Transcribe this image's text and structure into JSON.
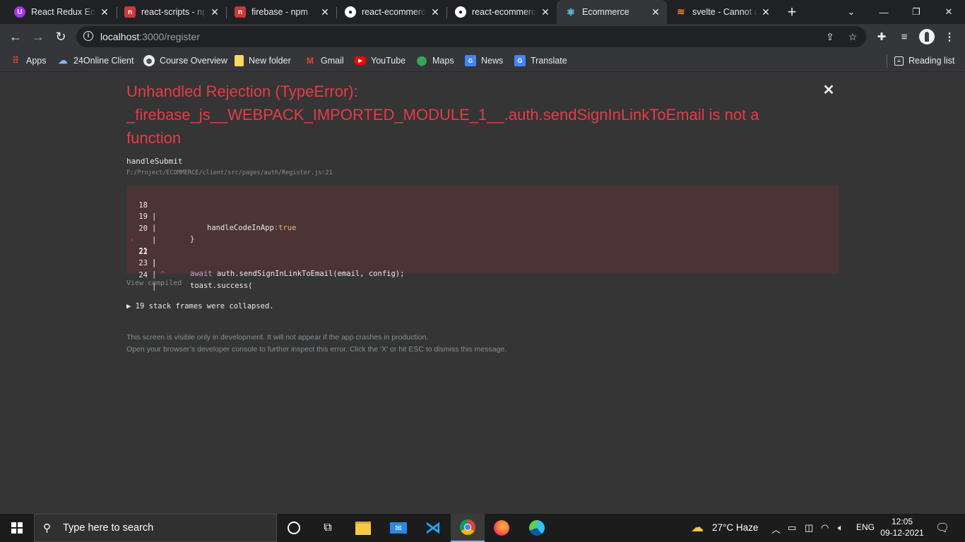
{
  "tabs": [
    {
      "title": "React Redux Ecom",
      "icon": "udemy-icon",
      "color": "#a435f0"
    },
    {
      "title": "react-scripts - np",
      "icon": "npm-icon",
      "color": "#cb3837"
    },
    {
      "title": "firebase - npm",
      "icon": "npm-icon",
      "color": "#cb3837"
    },
    {
      "title": "react-ecommerce",
      "icon": "github-icon",
      "color": "#ffffff"
    },
    {
      "title": "react-ecommerce",
      "icon": "github-icon",
      "color": "#ffffff"
    },
    {
      "title": "Ecommerce",
      "icon": "react-icon",
      "color": "#61dafb"
    },
    {
      "title": "svelte - Cannot a",
      "icon": "stackoverflow-icon",
      "color": "#f48024"
    }
  ],
  "address": {
    "host": "localhost",
    "path": ":3000/register"
  },
  "bookmarks": [
    {
      "label": "Apps",
      "icon": "apps-grid-icon",
      "color": "#ea4335"
    },
    {
      "label": "24Online Client",
      "icon": "cloud-icon",
      "color": "#8ab4f8"
    },
    {
      "label": "Course Overview",
      "icon": "globe-icon",
      "color": "#e8eaed"
    },
    {
      "label": "New folder",
      "icon": "folder-icon",
      "color": "#fdd663"
    },
    {
      "label": "Gmail",
      "icon": "gmail-icon",
      "color": "#ea4335"
    },
    {
      "label": "YouTube",
      "icon": "youtube-icon",
      "color": "#ff0000"
    },
    {
      "label": "Maps",
      "icon": "maps-icon",
      "color": "#34a853"
    },
    {
      "label": "News",
      "icon": "news-icon",
      "color": "#4285f4"
    },
    {
      "label": "Translate",
      "icon": "translate-icon",
      "color": "#4285f4"
    }
  ],
  "reading_list": "Reading list",
  "error": {
    "title": "Unhandled Rejection (TypeError): _firebase_js__WEBPACK_IMPORTED_MODULE_1__.auth.sendSignInLinkToEmail is not a function",
    "function_name": "handleSubmit",
    "file_path": "F:/Project/ECOMMERCE/client/src/pages/auth/Register.js:21",
    "code_lines": [
      {
        "num": "18",
        "code": "handleCodeInApp:true"
      },
      {
        "num": "19",
        "code": "}"
      },
      {
        "num": "20",
        "code": ""
      },
      {
        "num": "21",
        "code": "await auth.sendSignInLinkToEmail(email, config);"
      },
      {
        "num": "22",
        "code": "^"
      },
      {
        "num": "23",
        "code": "toast.success("
      },
      {
        "num": "24",
        "code": ""
      }
    ],
    "view_compiled": "View compiled",
    "collapsed_frames": "19 stack frames were collapsed.",
    "footer_line1": "This screen is visible only in development. It will not appear if the app crashes in production.",
    "footer_line2": "Open your browser’s developer console to further inspect this error.  Click the 'X' or hit ESC to dismiss this message."
  },
  "taskbar": {
    "search_placeholder": "Type here to search",
    "weather": "27°C  Haze",
    "language": "ENG",
    "time": "12:05",
    "date": "09-12-2021"
  },
  "colors": {
    "error_red": "#e83b46",
    "code_bg": "#4c3434",
    "overlay_bg": "#353535"
  }
}
